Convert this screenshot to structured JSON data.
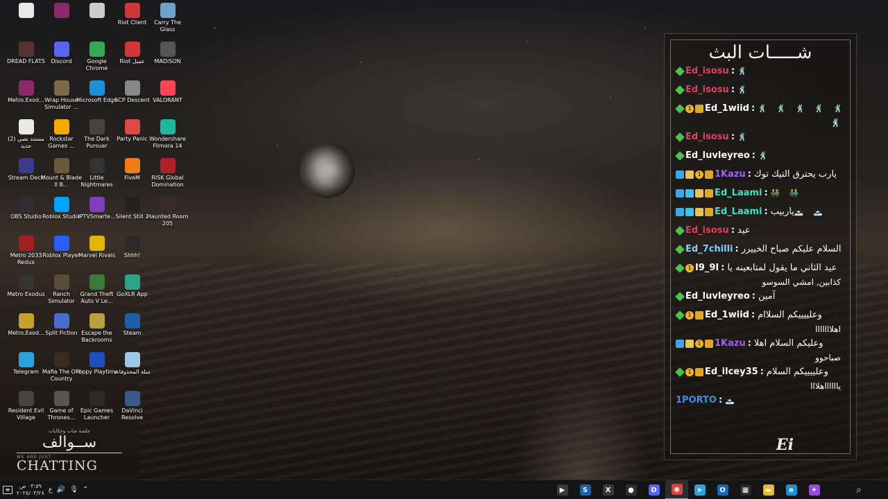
{
  "desktop": {
    "icons": [
      {
        "label": "",
        "icon": "doc-icon",
        "color": "#e8e8e8"
      },
      {
        "label": "",
        "icon": "winrar-icon",
        "color": "#8a2a6a"
      },
      {
        "label": "",
        "icon": "pen-icon",
        "color": "#cccccc"
      },
      {
        "label": "Riot Client",
        "icon": "riot-icon",
        "color": "#d13639"
      },
      {
        "label": "Carry The Glass",
        "icon": "game-icon",
        "color": "#6fa0c8"
      },
      {
        "label": "DREAD FLATS",
        "icon": "game-icon",
        "color": "#553333"
      },
      {
        "label": "Discord",
        "icon": "discord-icon",
        "color": "#5865f2"
      },
      {
        "label": "Google Chrome",
        "icon": "chrome-icon",
        "color": "#34a853"
      },
      {
        "label": "Riot عميل",
        "icon": "riot-icon",
        "color": "#d13639"
      },
      {
        "label": "MADiSON",
        "icon": "game-icon",
        "color": "#555555"
      },
      {
        "label": "Metro.Exod...",
        "icon": "winrar-icon",
        "color": "#8a2a6a"
      },
      {
        "label": "Wrap House Simulator ...",
        "icon": "game-icon",
        "color": "#7a6a4a"
      },
      {
        "label": "Microsoft Edge",
        "icon": "edge-icon",
        "color": "#1d8fd6"
      },
      {
        "label": "SCP Descent",
        "icon": "game-icon",
        "color": "#888888"
      },
      {
        "label": "VALORANT",
        "icon": "valorant-icon",
        "color": "#ff4655"
      },
      {
        "label": "مستند نصي (2) جديد",
        "icon": "doc-icon",
        "color": "#e8e8e8"
      },
      {
        "label": "Rockstar Games ...",
        "icon": "rockstar-icon",
        "color": "#f2a900"
      },
      {
        "label": "The Dark Pursuer",
        "icon": "game-icon",
        "color": "#444444"
      },
      {
        "label": "Party Panic",
        "icon": "game-icon",
        "color": "#e04848"
      },
      {
        "label": "Wondershare Filmora 14",
        "icon": "filmora-icon",
        "color": "#1fb6a0"
      },
      {
        "label": "Stream Deck",
        "icon": "streamdeck-icon",
        "color": "#3b3b8a"
      },
      {
        "label": "Mount & Blade II B...",
        "icon": "game-icon",
        "color": "#6b5a3a"
      },
      {
        "label": "Little Nightmares",
        "icon": "game-icon",
        "color": "#333333"
      },
      {
        "label": "FiveM",
        "icon": "fivem-icon",
        "color": "#f07d1a"
      },
      {
        "label": "RISK Global Domination",
        "icon": "game-icon",
        "color": "#b0202a"
      },
      {
        "label": "OBS Studio",
        "icon": "obs-icon",
        "color": "#302e31"
      },
      {
        "label": "Roblox Studio",
        "icon": "roblox-icon",
        "color": "#00a2ff"
      },
      {
        "label": "IPTVSmarte...",
        "icon": "tv-icon",
        "color": "#7b3fbf"
      },
      {
        "label": "Silent Still 2",
        "icon": "game-icon",
        "color": "#222222"
      },
      {
        "label": "Haunted Room 205",
        "icon": "game-icon",
        "color": "#3a2a2a"
      },
      {
        "label": "Metro 2033 Redux",
        "icon": "game-icon",
        "color": "#a02020"
      },
      {
        "label": "Roblox Player",
        "icon": "roblox-icon",
        "color": "#2b5cff"
      },
      {
        "label": "Marvel Rivals",
        "icon": "game-icon",
        "color": "#e2b400"
      },
      {
        "label": "Shhh!",
        "icon": "game-icon",
        "color": "#2a2a2a"
      },
      {
        "label": "",
        "icon": "",
        "color": ""
      },
      {
        "label": "Metro Exodus",
        "icon": "game-icon",
        "color": "#333333"
      },
      {
        "label": "Ranch Simulator",
        "icon": "game-icon",
        "color": "#5a4a3a"
      },
      {
        "label": "Grand Theft Auto V Le...",
        "icon": "gta-icon",
        "color": "#3a7a3a"
      },
      {
        "label": "GoXLR App",
        "icon": "goxlr-icon",
        "color": "#2aa58a"
      },
      {
        "label": "",
        "icon": "",
        "color": ""
      },
      {
        "label": "Metro.Exod...",
        "icon": "winrar-icon",
        "color": "#c8a030"
      },
      {
        "label": "Split Fiction",
        "icon": "game-icon",
        "color": "#4a6ad0"
      },
      {
        "label": "Escape the Backrooms",
        "icon": "game-icon",
        "color": "#b8a040"
      },
      {
        "label": "Steam",
        "icon": "steam-icon",
        "color": "#1b5fa8"
      },
      {
        "label": "",
        "icon": "",
        "color": ""
      },
      {
        "label": "Telegram",
        "icon": "telegram-icon",
        "color": "#2aa3dc"
      },
      {
        "label": "Mafia The Old Country",
        "icon": "game-icon",
        "color": "#3a2a20"
      },
      {
        "label": "Poppy Playtime",
        "icon": "game-icon",
        "color": "#2050c0"
      },
      {
        "label": "سلة المحذوفات",
        "icon": "recycle-bin-icon",
        "color": "#9ec8e8"
      },
      {
        "label": "",
        "icon": "",
        "color": ""
      },
      {
        "label": "Resident Evil Village",
        "icon": "game-icon",
        "color": "#444444"
      },
      {
        "label": "Game of Thrones...",
        "icon": "game-icon",
        "color": "#555555"
      },
      {
        "label": "Epic Games Launcher",
        "icon": "epic-icon",
        "color": "#2a2a2a"
      },
      {
        "label": "DaVinci Resolve",
        "icon": "davinci-icon",
        "color": "#3a5a8a"
      },
      {
        "label": "",
        "icon": "",
        "color": ""
      }
    ]
  },
  "logo": {
    "small": "جلسة شات وحكايات",
    "arabic": "ســوالف",
    "tiny": "WE ARE JUST",
    "big": "CHATTING"
  },
  "chat": {
    "title": "شـــــات البث",
    "logo": "Ei",
    "messages": [
      {
        "badges": [
          "diamond"
        ],
        "user": "Ed_isosu",
        "color": "#e0405a",
        "text": "",
        "emotes": "🕺",
        "text2": ""
      },
      {
        "badges": [
          "diamond"
        ],
        "user": "Ed_isosu",
        "color": "#e0405a",
        "text": "",
        "emotes": "🕺",
        "text2": ""
      },
      {
        "badges": [
          "diamond",
          "circle",
          "crown"
        ],
        "user": "Ed_1wiid",
        "color": "#ffffff",
        "text": "",
        "emotes": "🕺 🕺 🕺 🕺 🕺",
        "text2": "🕺"
      },
      {
        "badges": [
          "diamond"
        ],
        "user": "Ed_isosu",
        "color": "#e0405a",
        "text": "",
        "emotes": "🕺",
        "text2": ""
      },
      {
        "badges": [
          "diamond"
        ],
        "user": "Ed_luvleyreo",
        "color": "#ffffff",
        "text": "",
        "emotes": "🕺",
        "text2": ""
      },
      {
        "badges": [
          "blue",
          "tag",
          "circle",
          "crown"
        ],
        "user": "1Kazu",
        "color": "#a060f0",
        "text": "يارب يحترق التيك توك",
        "emotes": "",
        "text2": ""
      },
      {
        "badges": [
          "blue",
          "cube",
          "tag",
          "crown"
        ],
        "user": "Ed_Laami",
        "color": "#40e0c0",
        "text": "",
        "emotes": "👬 👬",
        "text2": ""
      },
      {
        "badges": [
          "blue",
          "cube",
          "tag",
          "crown"
        ],
        "user": "Ed_Laami",
        "color": "#40e0c0",
        "text": "ياربيب",
        "emotes": "🗻 🗻",
        "text2": ""
      },
      {
        "badges": [
          "diamond"
        ],
        "user": "Ed_isosu",
        "color": "#e0405a",
        "text": "عيد",
        "emotes": "",
        "text2": ""
      },
      {
        "badges": [
          "diamond"
        ],
        "user": "Ed_7chilli",
        "color": "#7ad3ff",
        "text": "السلام عليكم صباح الخييرر",
        "emotes": "",
        "text2": ""
      },
      {
        "badges": [
          "diamond",
          "circle"
        ],
        "user": "I9_9I",
        "color": "#ffffff",
        "text": "عيد الثاني ما يقول لمتابعينه يا",
        "emotes": "",
        "text2": "كذابين, امشي السوسو"
      },
      {
        "badges": [
          "diamond"
        ],
        "user": "Ed_luvleyreo",
        "color": "#ffffff",
        "text": "آمين",
        "emotes": "",
        "text2": ""
      },
      {
        "badges": [
          "diamond",
          "circle",
          "crown"
        ],
        "user": "Ed_1wiid",
        "color": "#ffffff",
        "text": "وعلييييكم السلاام",
        "emotes": "",
        "text2": "اهلااااااا"
      },
      {
        "badges": [
          "blue",
          "tag",
          "circle",
          "crown"
        ],
        "user": "1Kazu",
        "color": "#a060f0",
        "text": "وعليكم السلام اهلا",
        "emotes": "",
        "text2": "صباحوو"
      },
      {
        "badges": [
          "diamond",
          "circle",
          "crown"
        ],
        "user": "Ed_ilcey35",
        "color": "#ffffff",
        "text": "وعلييييكم السلام",
        "emotes": "",
        "text2": "يااااااهلااا"
      },
      {
        "badges": [],
        "user": "1PORTO",
        "color": "#3a8fe8",
        "text": "",
        "emotes": "🗻",
        "text2": ""
      }
    ]
  },
  "taskbar": {
    "clock_time": "٠٣:٥٩ ص",
    "clock_date": "٢٠٢٥/٠٣/٢٨",
    "lang": "ع",
    "apps": [
      {
        "name": "media-player-icon",
        "glyph": "▶",
        "color": "#3a3a3a",
        "active": false
      },
      {
        "name": "steam-icon",
        "glyph": "S",
        "color": "#1b5fa8",
        "active": false
      },
      {
        "name": "xbox-icon",
        "glyph": "X",
        "color": "#3a3a3a",
        "active": false
      },
      {
        "name": "obs-icon",
        "glyph": "●",
        "color": "#302e31",
        "active": false
      },
      {
        "name": "discord-icon",
        "glyph": "D",
        "color": "#5865f2",
        "active": false
      },
      {
        "name": "chrome-icon",
        "glyph": "◉",
        "color": "#db4437",
        "active": true
      },
      {
        "name": "telegram-icon",
        "glyph": "➤",
        "color": "#2aa3dc",
        "active": false
      },
      {
        "name": "outlook-icon",
        "glyph": "O",
        "color": "#0f6cbd",
        "active": false
      },
      {
        "name": "store-icon",
        "glyph": "▦",
        "color": "#2a2a2a",
        "active": false
      },
      {
        "name": "file-explorer-icon",
        "glyph": "▬",
        "color": "#e8b830",
        "active": false
      },
      {
        "name": "edge-icon",
        "glyph": "e",
        "color": "#1d8fd6",
        "active": false
      },
      {
        "name": "copilot-icon",
        "glyph": "✦",
        "color": "#9a4ae0",
        "active": false
      }
    ]
  }
}
